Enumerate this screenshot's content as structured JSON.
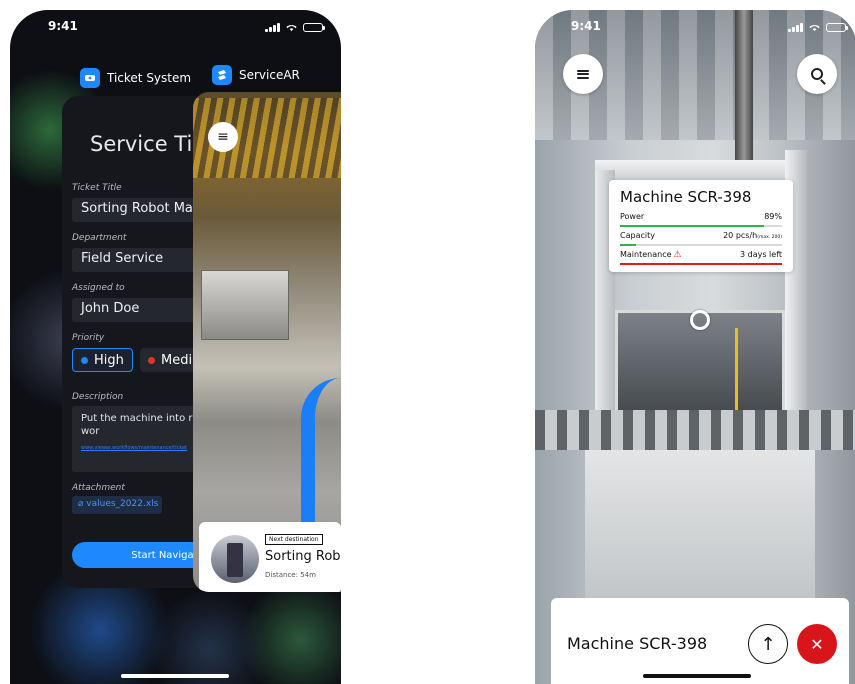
{
  "left_phone": {
    "status_time": "9:41",
    "apps": {
      "ticket": {
        "name": "Ticket System",
        "icon": "ticket-app-icon",
        "color": "#1e88ff"
      },
      "servicear": {
        "name": "ServiceAR",
        "icon": "servicear-app-icon",
        "color": "#1e88ff"
      }
    },
    "ticket_form": {
      "title": "Service Ticket",
      "fields": {
        "title_label": "Ticket Title",
        "title_value": "Sorting Robot Ma",
        "department_label": "Department",
        "department_value": "Field Service",
        "assigned_label": "Assigned to",
        "assigned_value": "John Doe",
        "priority_label": "Priority",
        "priority_high": "High",
        "priority_medium": "Medi",
        "description_label": "Description",
        "description_value": "Put the machine into r state and start the wor",
        "description_link": "www.viewar.workflows/maintenance/ticket",
        "attachment_label": "Attachment",
        "attachment_value": "values_2022.xls"
      },
      "start_button": "Start Navigation"
    },
    "ar_card": {
      "next_destination_tag": "Next destination",
      "destination_name": "Sorting Robo",
      "distance": "Distance: 54m"
    }
  },
  "right_phone": {
    "status_time": "9:41",
    "machine_card": {
      "title": "Machine SCR-398",
      "rows": [
        {
          "label": "Power",
          "value": "89%",
          "level": 89,
          "color": "#33b44a"
        },
        {
          "label": "Capacity",
          "value": "20 pcs/h",
          "value_suffix": "(max. 200)",
          "level": 10,
          "color": "#33b44a"
        },
        {
          "label": "Maintenance",
          "value": "3 days left",
          "level": 100,
          "color": "#e21b1b",
          "warning": "⚠"
        }
      ]
    },
    "bottom_sheet": {
      "title": "Machine SCR-398",
      "up_icon": "↑",
      "close_icon": "✕"
    },
    "accent_close": "#d7151a"
  }
}
